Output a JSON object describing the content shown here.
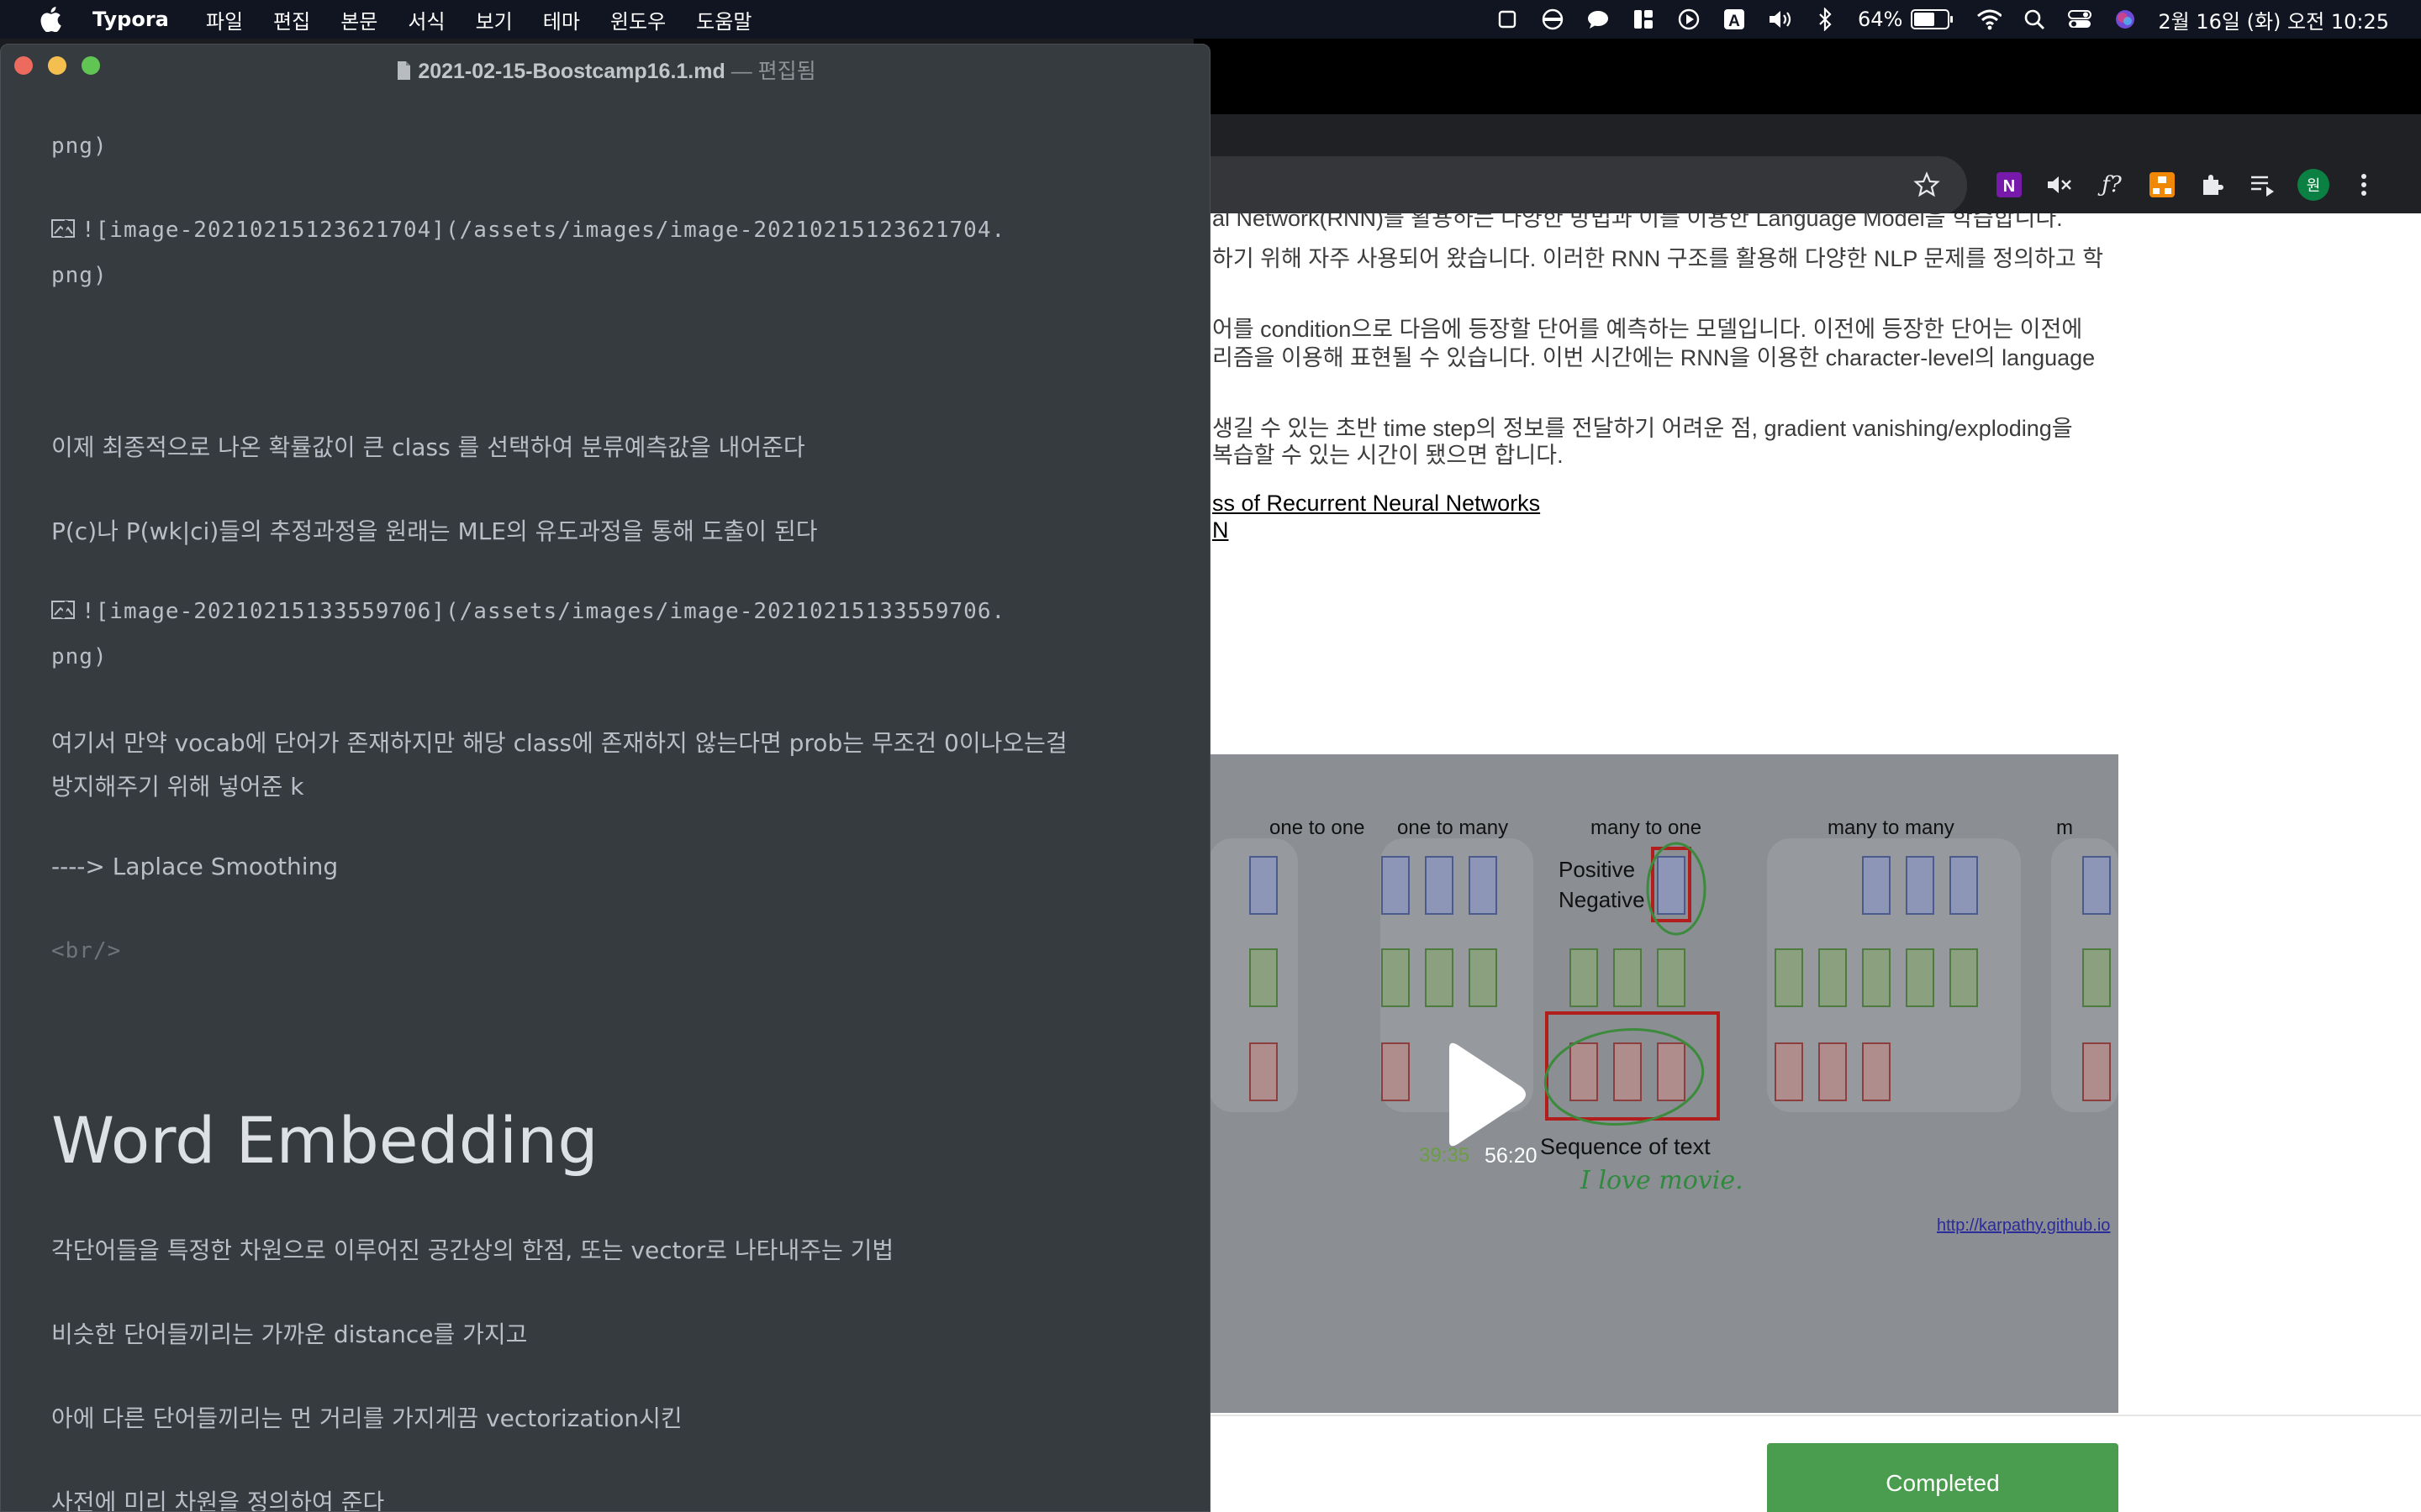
{
  "menubar": {
    "app_name": "Typora",
    "items": [
      "파일",
      "편집",
      "본문",
      "서식",
      "보기",
      "테마",
      "윈도우",
      "도움말"
    ],
    "battery_text": "64%",
    "battery_level": 0.64,
    "clock": "2월 16일 (화) 오전 10:25"
  },
  "typora": {
    "file_name": "2021-02-15-Boostcamp16.1.md",
    "title_sep": " — ",
    "title_status": "편집됨",
    "lines": {
      "png_tail_1": "png)",
      "img_1": "![image-20210215123621704](/assets/images/image-20210215123621704.",
      "png_tail_2": "png)",
      "p_select": "이제 최종적으로 나온 확률값이 큰 class 를 선택하여 분류예측값을 내어준다",
      "p_mle": "P(c)나 P(wk|ci)들의 추정과정을 원래는 MLE의 유도과정을 통해 도출이 된다",
      "img_2": "![image-20210215133559706](/assets/images/image-20210215133559706.",
      "png_tail_3": "png)",
      "p_vocab_1": "여기서 만약 vocab에 단어가 존재하지만 해당 class에 존재하지 않는다면 prob는 무조건 0이나오는걸",
      "p_vocab_2": "방지해주기 위해 넣어준 k",
      "p_laplace": "----> Laplace Smoothing",
      "p_br": "<br/>",
      "h1": "Word Embedding",
      "p_embed": "각단어들을 특정한 차원으로 이루어진 공간상의 한점, 또는 vector로 나타내주는 기법",
      "p_similar": "비슷한 단어들끼리는 가까운 distance를 가지고",
      "p_different": "아에 다른 단어들끼리는 먼 거리를 가지게끔 vectorization시킨",
      "p_dim": "사전에 미리 차원을 정의하여 준다"
    }
  },
  "browser": {
    "paragraphs": [
      "al Network(RNN)를 활용하는 다양한 방법과 이를 이용한 Language Model을 학습합니다.",
      "하기 위해 자주 사용되어 왔습니다. 이러한 RNN 구조를 활용해 다양한 NLP 문제를 정의하고 학",
      "어를 condition으로 다음에 등장할 단어를 예측하는 모델입니다. 이전에 등장한 단어는 이전에",
      "리즘을 이용해 표현될 수 있습니다. 이번 시간에는 RNN을 이용한 character-level의 language",
      "생길 수 있는 초반 time step의 정보를 전달하기 어려운 점, gradient vanishing/exploding을",
      " 복습할 수 있는 시간이 됐으면 합니다."
    ],
    "links": [
      "ss of Recurrent Neural Networks",
      "N"
    ],
    "video": {
      "labels": [
        "one to one",
        "one to many",
        "many to one",
        "many to many",
        "m"
      ],
      "positive": "Positive",
      "negative": "Negative",
      "caption": "Sequence of text",
      "handwriting": "I love movie.",
      "source_link": "http://karpathy.github.io",
      "time_current": "39:35",
      "time_total": "56:20"
    },
    "completed_label": "Completed",
    "profile_initial": "원"
  },
  "colors": {
    "typora_bg": "#363b40",
    "menubar_bg": "#111421",
    "completed": "#4a9d4f"
  }
}
